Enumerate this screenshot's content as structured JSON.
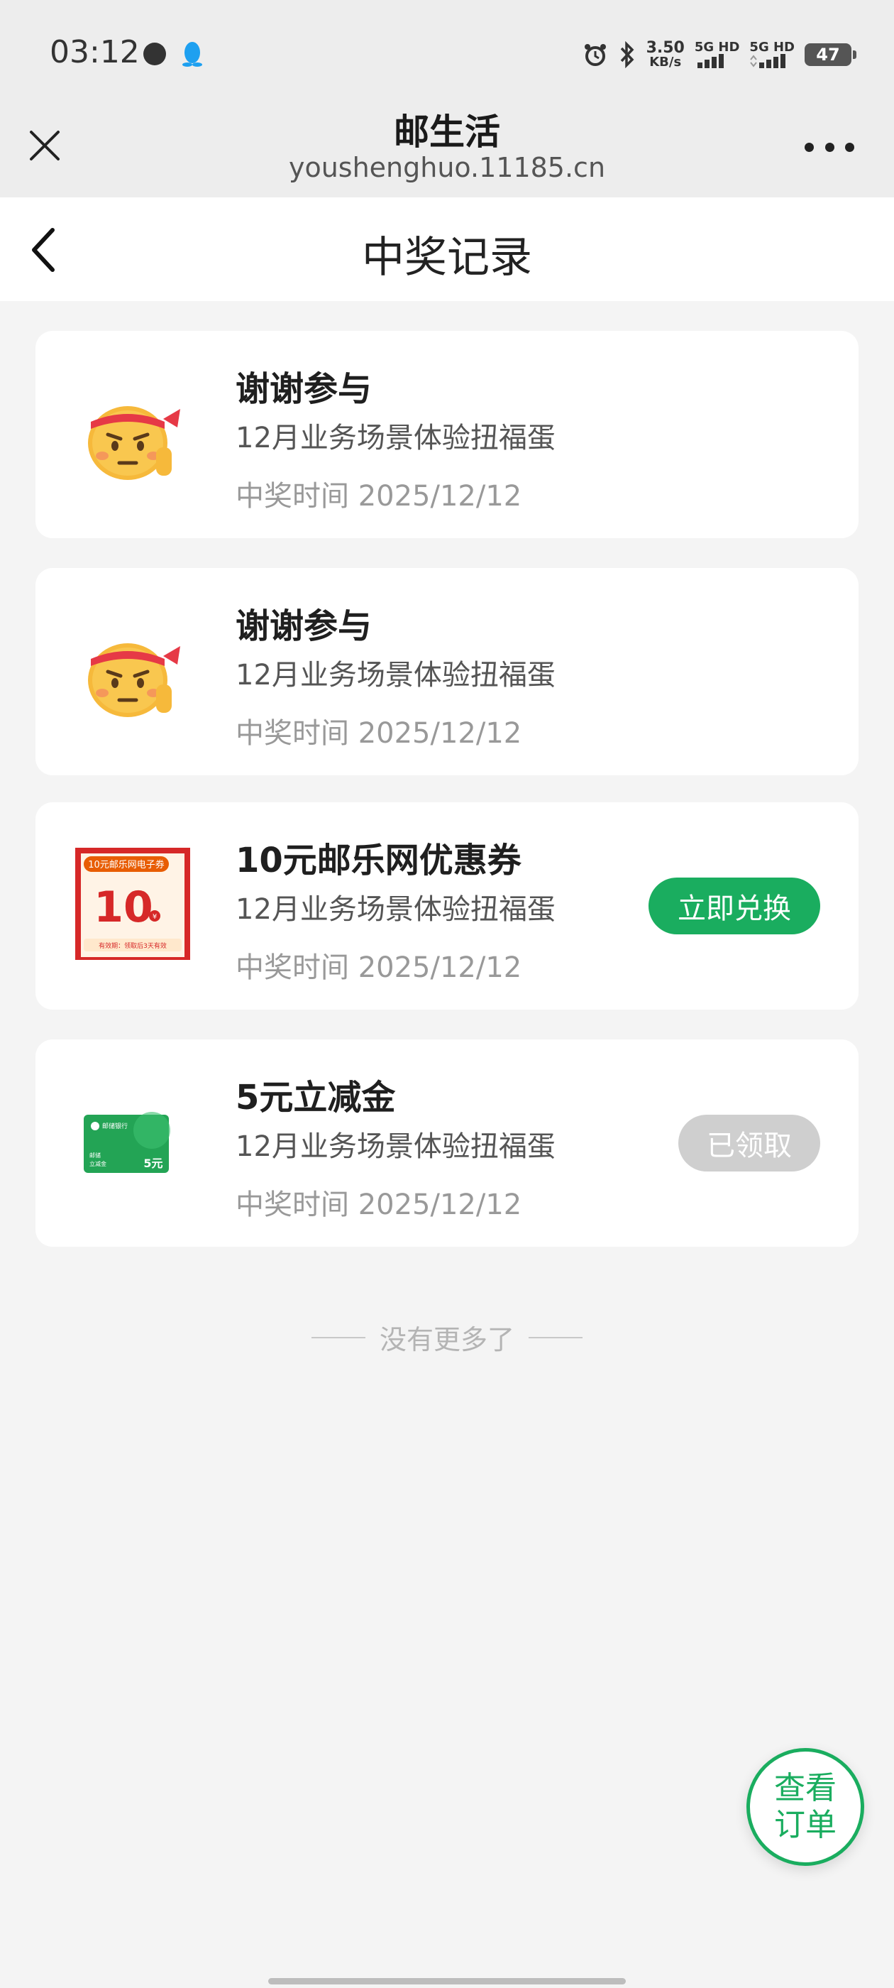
{
  "status_bar": {
    "time": "03:12",
    "speed_value": "3.50",
    "speed_unit": "KB/s",
    "sim1_label": "5G HD",
    "sim2_label": "5G HD",
    "battery": "47"
  },
  "title_bar": {
    "title": "邮生活",
    "url": "youshenghuo.11185.cn"
  },
  "page_header": {
    "title": "中奖记录"
  },
  "records": [
    {
      "name": "谢谢参与",
      "activity": "12月业务场景体验扭福蛋",
      "time": "中奖时间 2025/12/12",
      "icon": "thanks-emoji-icon"
    },
    {
      "name": "谢谢参与",
      "activity": "12月业务场景体验扭福蛋",
      "time": "中奖时间 2025/12/12",
      "icon": "thanks-emoji-icon"
    },
    {
      "name": "10元邮乐网优惠券",
      "activity": "12月业务场景体验扭福蛋",
      "time": "中奖时间 2025/12/12",
      "icon": "coupon-voucher-icon",
      "coupon_banner": "10元邮乐网电子券",
      "coupon_value": "10",
      "coupon_currency": "¥",
      "coupon_note": "有效期：领取后3天有效",
      "action_label": "立即兑换"
    },
    {
      "name": "5元立减金",
      "activity": "12月业务场景体验扭福蛋",
      "time": "中奖时间 2025/12/12",
      "icon": "discount-card-icon",
      "card_brand": "邮储银行",
      "card_line1": "邮储",
      "card_line2": "立减金",
      "card_value": "5元",
      "action_label": "已领取"
    }
  ],
  "footer_note": "没有更多了",
  "fab": {
    "line1": "查看",
    "line2": "订单"
  },
  "colors": {
    "accent": "#1aad5f",
    "disabled": "#cfcfcf",
    "page_bg": "#f4f4f4"
  }
}
